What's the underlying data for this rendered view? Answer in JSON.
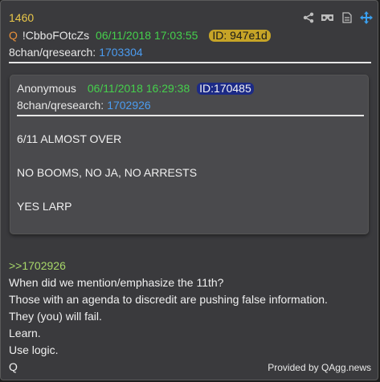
{
  "post": {
    "number": "1460",
    "q_letter": "Q",
    "tripcode": "!CbboFOtcZs",
    "date": "06/11/2018 17:03:55",
    "id_label": "ID: 947e1d",
    "board_prefix": "8chan/qresearch:",
    "board_link": "1703304",
    "icons": [
      "share-icon",
      "vr-glasses-icon",
      "document-icon",
      "move-arrows-icon"
    ]
  },
  "quoted": {
    "author": "Anonymous",
    "date": "06/11/2018 16:29:38",
    "id_label": "ID:170485",
    "board_prefix": "8chan/qresearch:",
    "board_link": "1702926",
    "lines": [
      "6/11 ALMOST OVER",
      "",
      "NO BOOMS, NO JA, NO ARRESTS",
      "",
      "YES LARP"
    ]
  },
  "body": {
    "reply_ref": ">>1702926",
    "lines": [
      "When did we mention/emphasize the 11th?",
      "Those with an agenda to discredit are pushing false information.",
      "They (you) will fail.",
      "Learn.",
      "Use logic.",
      "Q"
    ]
  },
  "footer": {
    "credit": "Provided by QAgg.news"
  },
  "colors": {
    "background": "#3a3a3d",
    "quote_background": "#4a4a4d",
    "post_number": "#e9c74a",
    "date": "#45d04c",
    "link": "#4b9cf0",
    "reply_ref": "#a8d86a",
    "id_badge": "#c6a427",
    "quote_id_badge": "#1c2a86",
    "move_icon": "#3aa0f0"
  }
}
